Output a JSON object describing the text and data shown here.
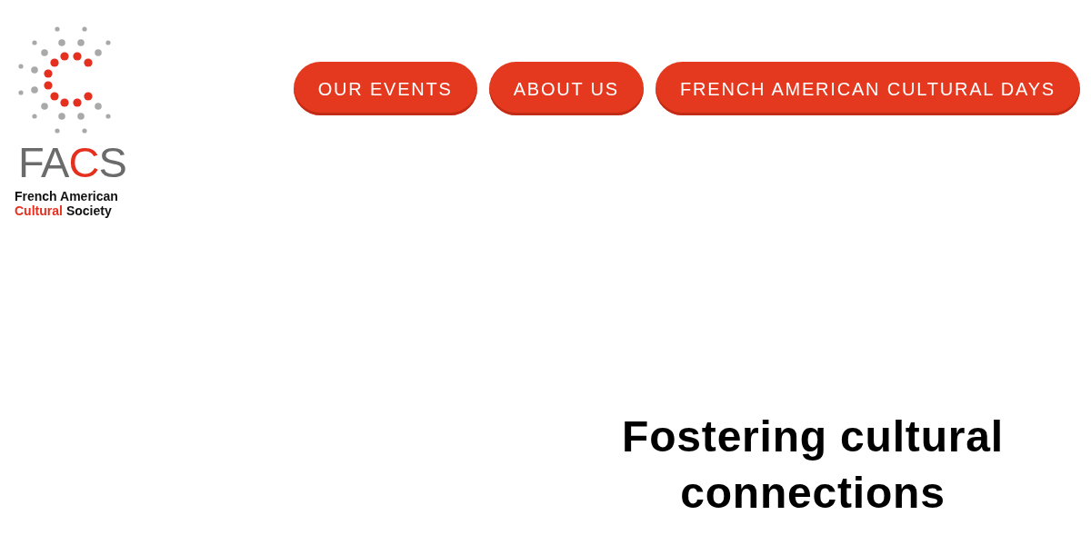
{
  "logo": {
    "wordmark": [
      {
        "text": "FA",
        "accent": false
      },
      {
        "text": "C",
        "accent": true
      },
      {
        "text": "S",
        "accent": false
      }
    ],
    "tagline": [
      {
        "parts": [
          {
            "text": "French American",
            "accent": false
          }
        ]
      },
      {
        "parts": [
          {
            "text": "Cultural",
            "accent": true
          },
          {
            "text": "Society",
            "accent": false
          }
        ]
      }
    ]
  },
  "nav": {
    "buttons": [
      "OUR EVENTS",
      "ABOUT US",
      "FRENCH AMERICAN CULTURAL DAYS"
    ]
  },
  "hero": {
    "heading": "Fostering cultural connections"
  }
}
